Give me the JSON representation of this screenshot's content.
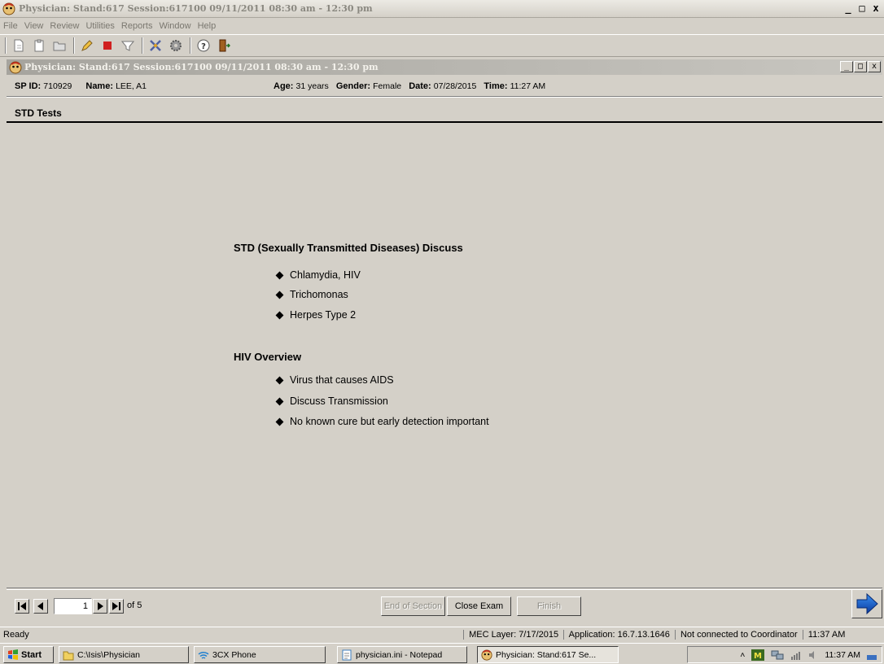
{
  "window": {
    "title": "Physician: Stand:617 Session:617100 09/11/2011 08:30 am - 12:30 pm",
    "controls": [
      "_",
      "□",
      "x"
    ]
  },
  "menu": [
    "File",
    "View",
    "Review",
    "Utilities",
    "Reports",
    "Window",
    "Help"
  ],
  "child": {
    "title": "Physician: Stand:617 Session:617100 09/11/2011 08:30 am - 12:30 pm"
  },
  "participant": {
    "spid_label": "SP ID:",
    "spid": "710929",
    "name_label": "Name:",
    "name": "LEE, A1",
    "age_label": "Age:",
    "age": "31 years",
    "gender_label": "Gender:",
    "gender": "Female",
    "date_label": "Date:",
    "date": "07/28/2015",
    "time_label": "Time:",
    "time": "11:27 AM"
  },
  "section": {
    "title": "STD Tests"
  },
  "content": {
    "heading1": "STD (Sexually Transmitted Diseases) Discuss",
    "list1": [
      "Chlamydia, HIV",
      "Trichomonas",
      "Herpes Type 2"
    ],
    "heading2": "HIV Overview",
    "list2": [
      "Virus that causes AIDS",
      "Discuss Transmission",
      "No known cure but early detection important"
    ]
  },
  "nav": {
    "page": "1",
    "of_pages": "of 5",
    "end_of_section": "End of Section",
    "close_exam": "Close Exam",
    "finish": "Finish"
  },
  "status": {
    "ready": "Ready",
    "mec_layer": "MEC Layer: 7/17/2015",
    "application": "Application: 16.7.13.1646",
    "coordinator": "Not connected to Coordinator",
    "time": "11:37 AM"
  },
  "taskbar": {
    "start": "Start",
    "items": [
      "C:\\Isis\\Physician",
      "3CX Phone",
      "physician.ini - Notepad",
      "Physician: Stand:617 Se..."
    ],
    "clock": "11:37 AM"
  }
}
